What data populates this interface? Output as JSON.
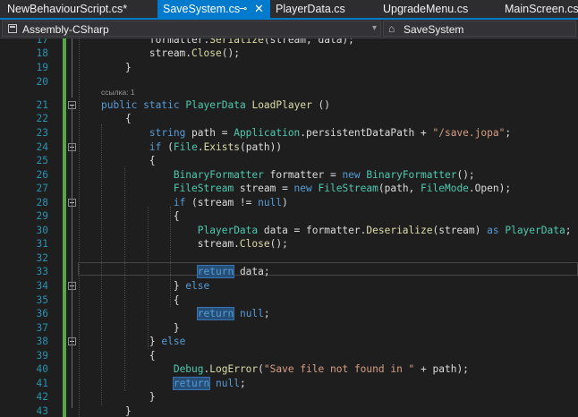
{
  "tabs": [
    {
      "label": "NewBehaviourScript.cs*",
      "active": false
    },
    {
      "label": "SaveSystem.cs",
      "active": true,
      "pin_icon": "pin-icon",
      "close_icon": "close-icon"
    },
    {
      "label": "PlayerData.cs",
      "active": false
    },
    {
      "label": "UpgradeMenu.cs",
      "active": false
    },
    {
      "label": "MainScreen.cs",
      "active": false
    }
  ],
  "tab_glyphs": {
    "pin": "⊸",
    "close": "✕"
  },
  "navbar": {
    "project": "Assembly-CSharp",
    "member": "SaveSystem",
    "arrow": "▾",
    "member_glyph": "⌂"
  },
  "codelens": "ссылка: 1",
  "colors": {
    "keyword": "#569cd6",
    "type": "#4ec9b0",
    "method": "#dcdcaa",
    "string": "#d69d85",
    "line_number": "#2b91af",
    "accent": "#007acc",
    "change_bar": "#57a64a"
  },
  "lines": [
    {
      "num": "17",
      "tokens": [
        [
          "tx",
          "        formatter."
        ],
        [
          "fn",
          "Serialize"
        ],
        [
          "tx",
          "(stream, data);"
        ]
      ]
    },
    {
      "num": "18",
      "tokens": [
        [
          "tx",
          "        stream."
        ],
        [
          "fn",
          "Close"
        ],
        [
          "tx",
          "();"
        ]
      ]
    },
    {
      "num": "19",
      "tokens": [
        [
          "tx",
          "    }"
        ]
      ]
    },
    {
      "num": "20",
      "tokens": []
    },
    {
      "num": "21",
      "fold": true,
      "tokens": [
        [
          "kw",
          "public"
        ],
        [
          "tx",
          " "
        ],
        [
          "kw",
          "static"
        ],
        [
          "tx",
          " "
        ],
        [
          "ty",
          "PlayerData"
        ],
        [
          "tx",
          " "
        ],
        [
          "fn",
          "LoadPlayer"
        ],
        [
          "tx",
          " ()"
        ]
      ]
    },
    {
      "num": "22",
      "tokens": [
        [
          "tx",
          "    {"
        ]
      ]
    },
    {
      "num": "23",
      "tokens": [
        [
          "tx",
          "        "
        ],
        [
          "kw",
          "string"
        ],
        [
          "tx",
          " path = "
        ],
        [
          "ty",
          "Application"
        ],
        [
          "tx",
          ".persistentDataPath + "
        ],
        [
          "st",
          "\"/save.jopa\""
        ],
        [
          "tx",
          ";"
        ]
      ]
    },
    {
      "num": "24",
      "fold": true,
      "tokens": [
        [
          "tx",
          "        "
        ],
        [
          "kw",
          "if"
        ],
        [
          "tx",
          " ("
        ],
        [
          "ty",
          "File"
        ],
        [
          "tx",
          "."
        ],
        [
          "fn",
          "Exists"
        ],
        [
          "tx",
          "(path))"
        ]
      ]
    },
    {
      "num": "25",
      "tokens": [
        [
          "tx",
          "        {"
        ]
      ]
    },
    {
      "num": "26",
      "tokens": [
        [
          "tx",
          "            "
        ],
        [
          "ty",
          "BinaryFormatter"
        ],
        [
          "tx",
          " formatter = "
        ],
        [
          "kw",
          "new"
        ],
        [
          "tx",
          " "
        ],
        [
          "ty",
          "BinaryFormatter"
        ],
        [
          "tx",
          "();"
        ]
      ]
    },
    {
      "num": "27",
      "tokens": [
        [
          "tx",
          "            "
        ],
        [
          "ty",
          "FileStream"
        ],
        [
          "tx",
          " stream = "
        ],
        [
          "kw",
          "new"
        ],
        [
          "tx",
          " "
        ],
        [
          "ty",
          "FileStream"
        ],
        [
          "tx",
          "(path, "
        ],
        [
          "ty",
          "FileMode"
        ],
        [
          "tx",
          ".Open);"
        ]
      ]
    },
    {
      "num": "28",
      "fold": true,
      "tokens": [
        [
          "tx",
          "            "
        ],
        [
          "kw",
          "if"
        ],
        [
          "tx",
          " (stream != "
        ],
        [
          "kw",
          "null"
        ],
        [
          "tx",
          ")"
        ]
      ]
    },
    {
      "num": "29",
      "tokens": [
        [
          "tx",
          "            {"
        ]
      ]
    },
    {
      "num": "30",
      "tokens": [
        [
          "tx",
          "                "
        ],
        [
          "ty",
          "PlayerData"
        ],
        [
          "tx",
          " data = formatter."
        ],
        [
          "fn",
          "Deserialize"
        ],
        [
          "tx",
          "(stream) "
        ],
        [
          "kw",
          "as"
        ],
        [
          "tx",
          " "
        ],
        [
          "ty",
          "PlayerData"
        ],
        [
          "tx",
          ";"
        ]
      ]
    },
    {
      "num": "31",
      "tokens": [
        [
          "tx",
          "                stream."
        ],
        [
          "fn",
          "Close"
        ],
        [
          "tx",
          "();"
        ]
      ]
    },
    {
      "num": "32",
      "tokens": []
    },
    {
      "num": "33",
      "tokens": [
        [
          "tx",
          "                "
        ],
        [
          "rt",
          "return"
        ],
        [
          "tx",
          " data;"
        ]
      ]
    },
    {
      "num": "34",
      "fold": true,
      "tokens": [
        [
          "tx",
          "            } "
        ],
        [
          "kw",
          "else"
        ]
      ]
    },
    {
      "num": "35",
      "tokens": [
        [
          "tx",
          "            {"
        ]
      ]
    },
    {
      "num": "36",
      "tokens": [
        [
          "tx",
          "                "
        ],
        [
          "rt",
          "return"
        ],
        [
          "tx",
          " "
        ],
        [
          "kw",
          "null"
        ],
        [
          "tx",
          ";"
        ]
      ]
    },
    {
      "num": "37",
      "tokens": [
        [
          "tx",
          "            }"
        ]
      ]
    },
    {
      "num": "38",
      "fold": true,
      "tokens": [
        [
          "tx",
          "        } "
        ],
        [
          "kw",
          "else"
        ]
      ]
    },
    {
      "num": "39",
      "tokens": [
        [
          "tx",
          "        {"
        ]
      ]
    },
    {
      "num": "40",
      "tokens": [
        [
          "tx",
          "            "
        ],
        [
          "ty",
          "Debug"
        ],
        [
          "tx",
          "."
        ],
        [
          "fn",
          "LogError"
        ],
        [
          "tx",
          "("
        ],
        [
          "st",
          "\"Save file not found in \""
        ],
        [
          "tx",
          " + path);"
        ]
      ]
    },
    {
      "num": "41",
      "tokens": [
        [
          "tx",
          "            "
        ],
        [
          "rt",
          "return"
        ],
        [
          "tx",
          " "
        ],
        [
          "kw",
          "null"
        ],
        [
          "tx",
          ";"
        ]
      ]
    },
    {
      "num": "42",
      "tokens": [
        [
          "tx",
          "        }"
        ]
      ]
    },
    {
      "num": "43",
      "tokens": [
        [
          "tx",
          "    }"
        ]
      ]
    }
  ]
}
